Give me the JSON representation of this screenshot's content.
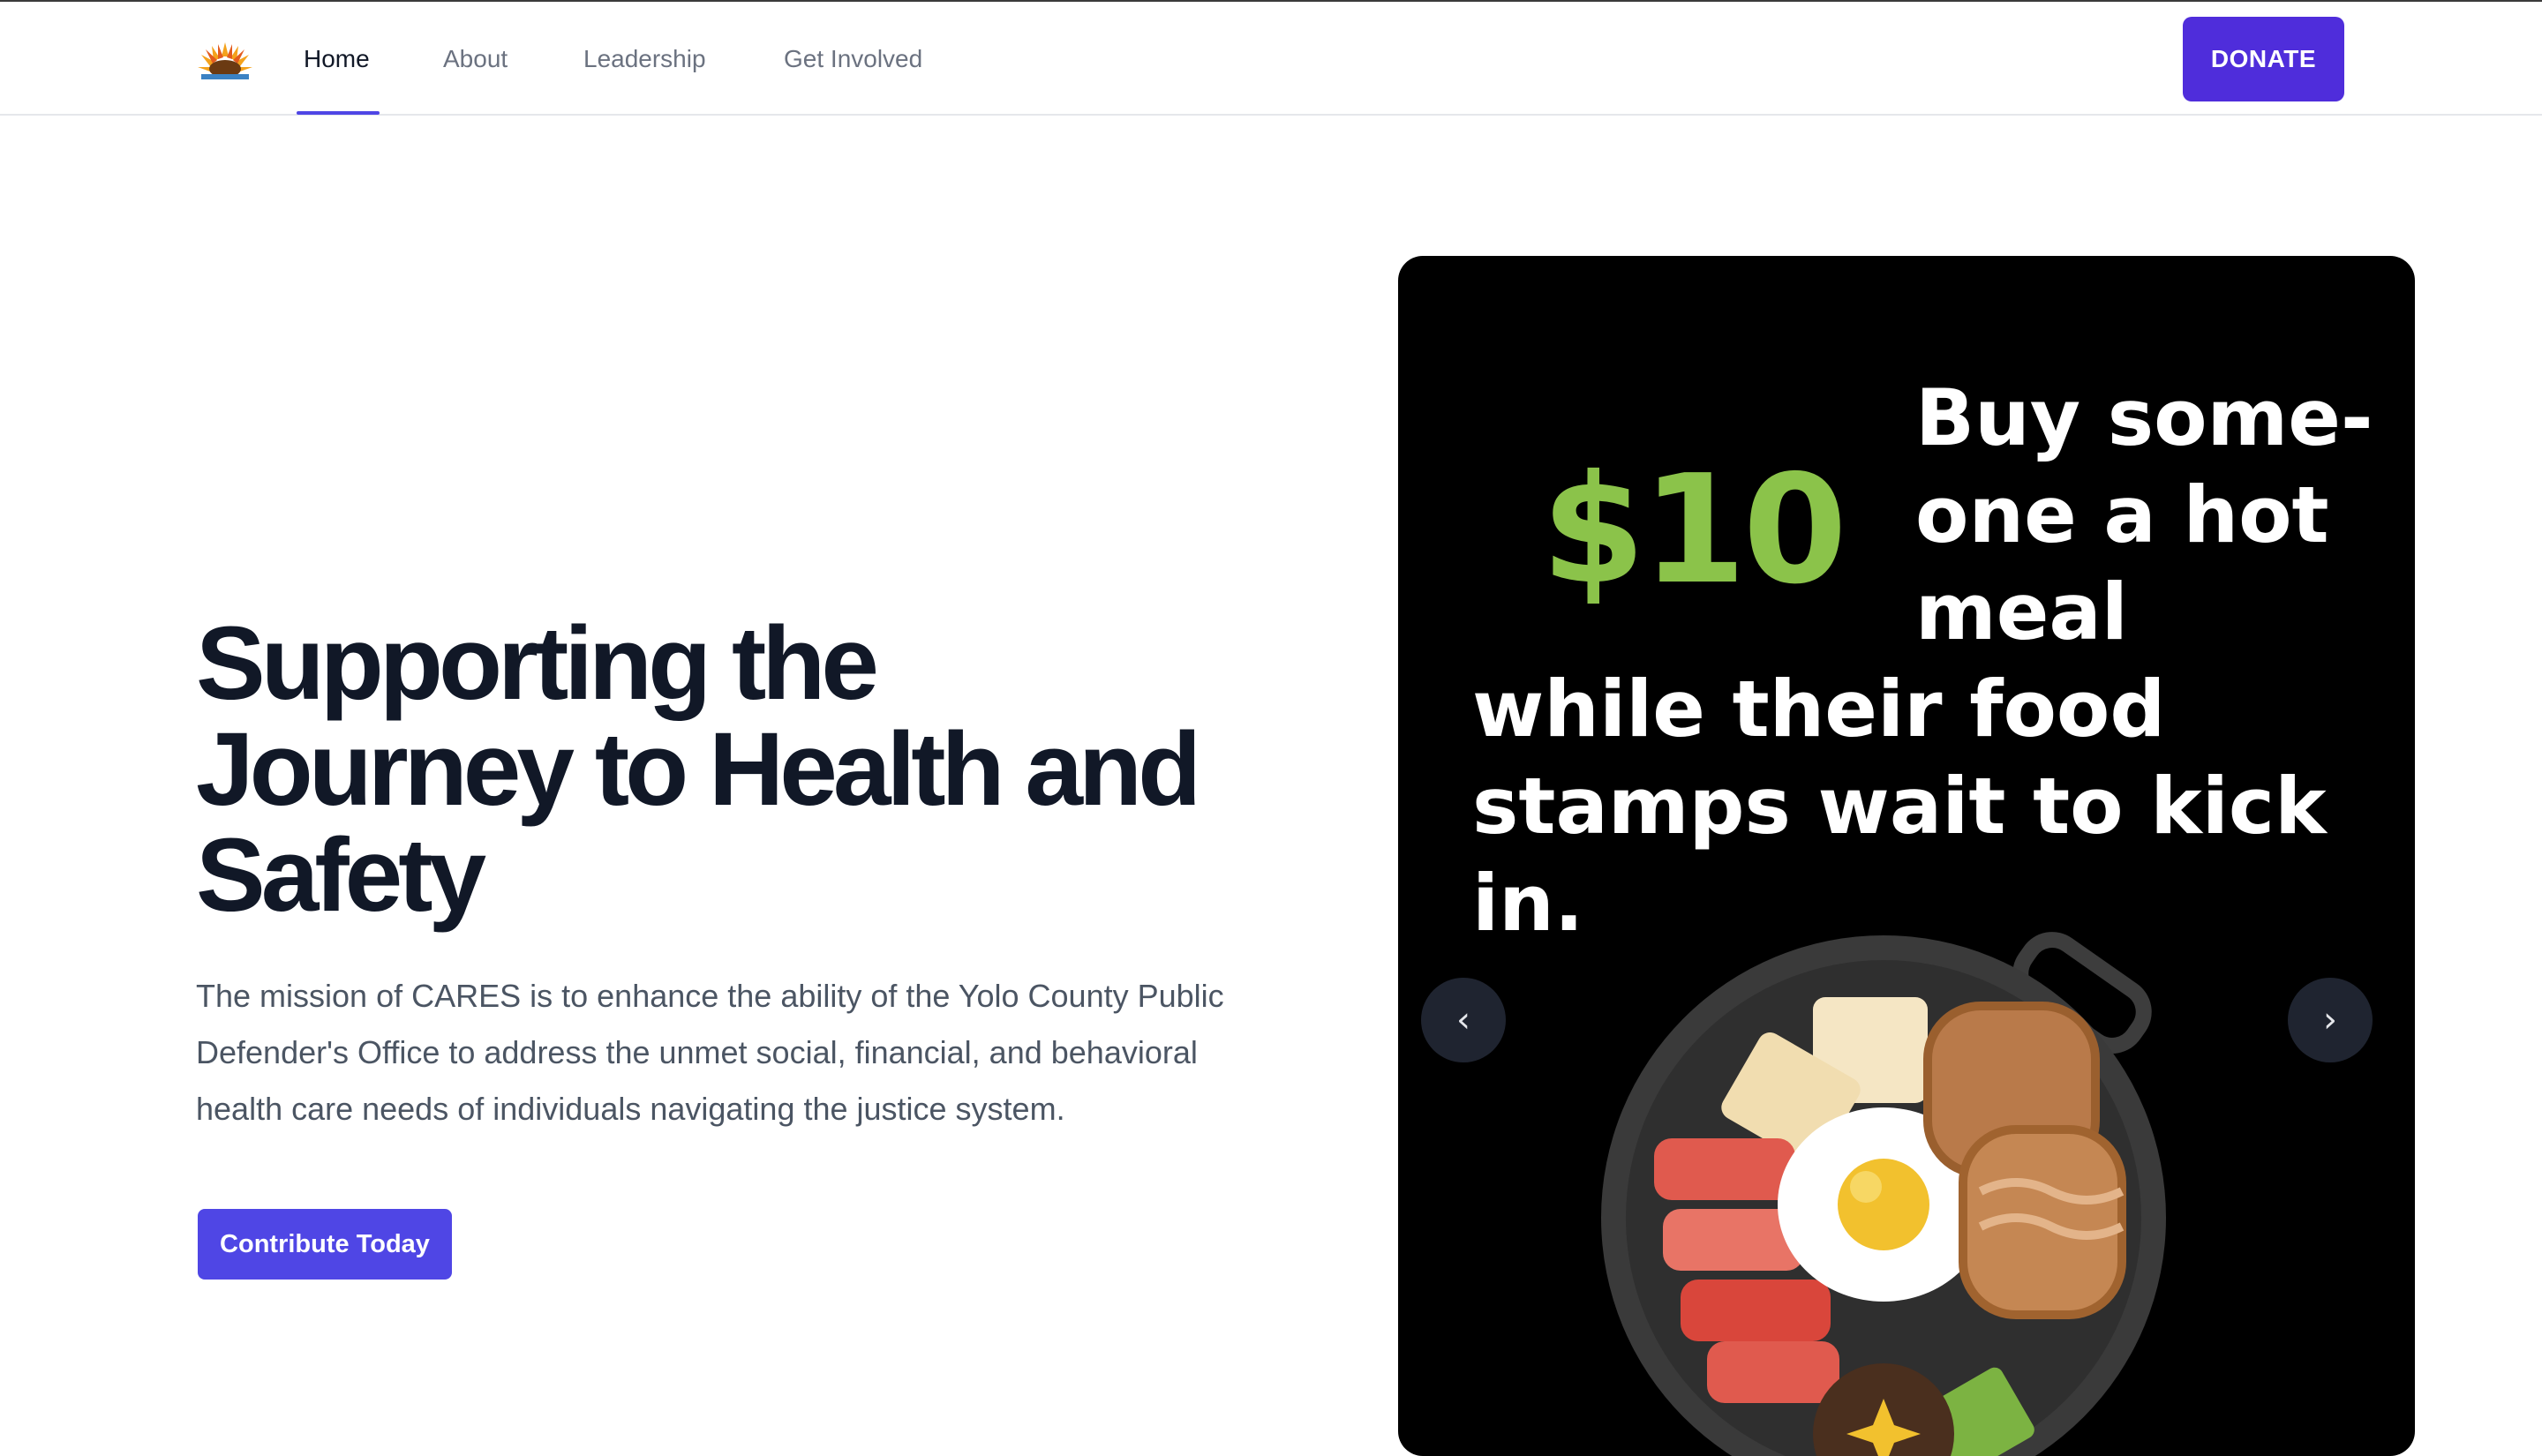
{
  "nav": {
    "links": [
      {
        "label": "Home",
        "active": true
      },
      {
        "label": "About",
        "active": false
      },
      {
        "label": "Leadership",
        "active": false
      },
      {
        "label": "Get Involved",
        "active": false
      }
    ],
    "donate_label": "DONATE"
  },
  "hero": {
    "title_lines": [
      "Supporting the",
      "Journey to Health and",
      "Safety"
    ],
    "description": "The mission of CARES is to enhance the ability of the Yolo County Public Defender's Office to address the unmet social, financial, and behavioral health care needs of individuals navigating the justice system.",
    "cta_label": "Contribute Today"
  },
  "carousel": {
    "slide": {
      "price": "$10",
      "headline_lines": [
        "Buy some-",
        "one a hot",
        "meal",
        "while their food",
        "stamps wait to kick",
        "in."
      ]
    },
    "prev_icon": "chevron-left-icon",
    "next_icon": "chevron-right-icon",
    "prev_symbol": "‹",
    "next_symbol": "›"
  },
  "colors": {
    "accent": "#4f46e5",
    "donate": "#4f2ddb",
    "price_green": "#8bc34a"
  }
}
